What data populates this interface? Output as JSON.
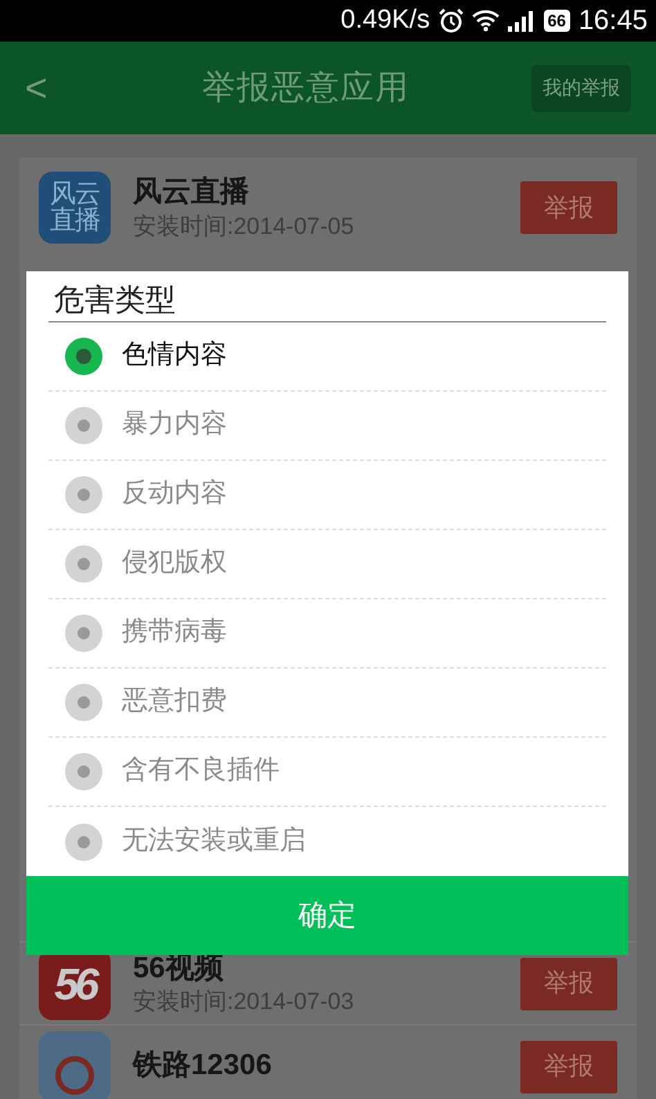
{
  "status_bar": {
    "speed": "0.49K/s",
    "battery": "66",
    "time": "16:45"
  },
  "header": {
    "back": "<",
    "title": "举报恶意应用",
    "action": "我的举报"
  },
  "apps": [
    {
      "name": "风云直播",
      "installed": "安装时间:2014-07-05",
      "report": "举报",
      "icon": {
        "kind": "fengyun",
        "lines": [
          "风云",
          "直播"
        ]
      }
    },
    {
      "name": "56视频",
      "installed": "安装时间:2014-07-03",
      "report": "举报",
      "icon": {
        "kind": "video56",
        "lines": [
          "56"
        ]
      }
    },
    {
      "name": "铁路12306",
      "report": "举报",
      "icon": {
        "kind": "rail"
      }
    }
  ],
  "dialog": {
    "title": "危害类型",
    "confirm": "确定",
    "options": [
      {
        "label": "色情内容",
        "selected": true
      },
      {
        "label": "暴力内容",
        "selected": false
      },
      {
        "label": "反动内容",
        "selected": false
      },
      {
        "label": "侵犯版权",
        "selected": false
      },
      {
        "label": "携带病毒",
        "selected": false
      },
      {
        "label": "恶意扣费",
        "selected": false
      },
      {
        "label": "含有不良插件",
        "selected": false
      },
      {
        "label": "无法安装或重启",
        "selected": false
      }
    ]
  }
}
